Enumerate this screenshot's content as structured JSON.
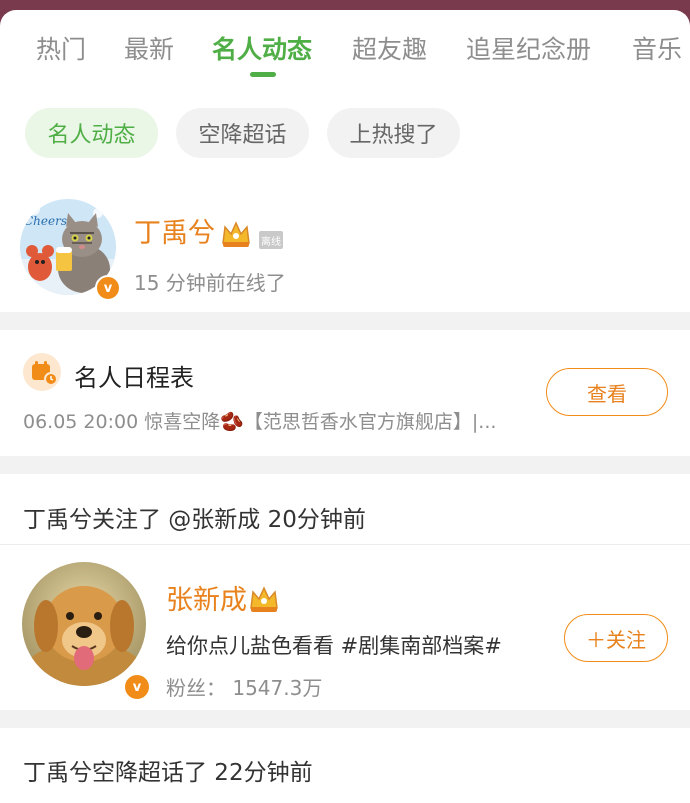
{
  "tabs": [
    {
      "label": "热门"
    },
    {
      "label": "最新"
    },
    {
      "label": "名人动态"
    },
    {
      "label": "超友趣"
    },
    {
      "label": "追星纪念册"
    },
    {
      "label": "音乐"
    }
  ],
  "active_tab_index": 2,
  "chips": [
    {
      "label": "名人动态"
    },
    {
      "label": "空降超话"
    },
    {
      "label": "上热搜了"
    }
  ],
  "active_chip_index": 0,
  "profile": {
    "name": "丁禹兮",
    "status_tag": "离线",
    "status": "15 分钟前在线了",
    "verified_icon": "v-badge-icon",
    "avatar_icon": "cat-cheers-avatar"
  },
  "schedule": {
    "title": "名人日程表",
    "detail": "06.05 20:00 惊喜空降🫘【范思哲香水官方旗舰店】|...",
    "button": "查看",
    "icon": "schedule-icon"
  },
  "follow_event": {
    "text": "丁禹兮关注了 @张新成 20分钟前"
  },
  "followed_user": {
    "name": "张新成",
    "bio": "给你点儿盐色看看 #剧集南部档案#",
    "fans": "粉丝： 1547.3万",
    "button": "＋关注",
    "avatar_icon": "golden-retriever-avatar"
  },
  "supertopic_event": {
    "text": "丁禹兮空降超话了 22分钟前"
  },
  "colors": {
    "accent_green": "#4fae45",
    "name_orange": "#e8821e",
    "badge_orange": "#f28c18",
    "header_maroon": "#7a3a4e"
  }
}
